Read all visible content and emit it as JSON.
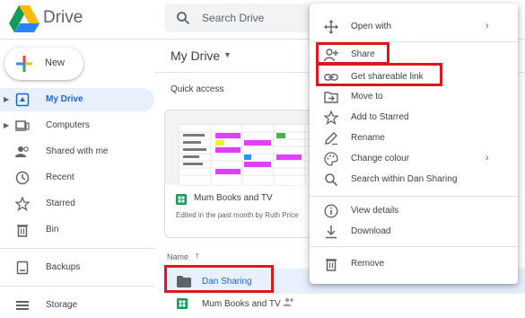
{
  "header": {
    "brand": "Drive",
    "search_placeholder": "Search Drive"
  },
  "sidebar": {
    "new_label": "New",
    "items": [
      {
        "label": "My Drive",
        "icon": "my-drive-icon",
        "selected": true
      },
      {
        "label": "Computers",
        "icon": "computers-icon"
      },
      {
        "label": "Shared with me",
        "icon": "shared-with-me-icon"
      },
      {
        "label": "Recent",
        "icon": "recent-icon"
      },
      {
        "label": "Starred",
        "icon": "star-icon"
      },
      {
        "label": "Bin",
        "icon": "bin-icon"
      },
      {
        "label": "Backups",
        "icon": "backups-icon"
      },
      {
        "label": "Storage",
        "icon": "storage-icon"
      }
    ]
  },
  "main": {
    "title": "My Drive",
    "quick_access": "Quick access",
    "card": {
      "name": "Mum Books and TV",
      "subtitle": "Edited in the past month by Ruth Price"
    },
    "column_header": "Name",
    "rows": [
      {
        "name": "Dan Sharing",
        "type": "folder",
        "selected": true
      },
      {
        "name": "Mum Books and TV",
        "type": "sheet",
        "shared": true
      }
    ]
  },
  "context_menu": {
    "items": [
      {
        "label": "Open with",
        "icon": "open-with-icon",
        "submenu": true
      },
      {
        "label": "Share",
        "icon": "share-person-icon"
      },
      {
        "label": "Get shareable link",
        "icon": "link-icon"
      },
      {
        "label": "Move to",
        "icon": "move-to-icon"
      },
      {
        "label": "Add to Starred",
        "icon": "star-icon"
      },
      {
        "label": "Rename",
        "icon": "rename-icon"
      },
      {
        "label": "Change colour",
        "icon": "palette-icon",
        "submenu": true
      },
      {
        "label": "Search within Dan Sharing",
        "icon": "search-icon"
      },
      {
        "label": "View details",
        "icon": "info-icon"
      },
      {
        "label": "Download",
        "icon": "download-icon"
      },
      {
        "label": "Remove",
        "icon": "trash-icon"
      }
    ]
  },
  "colors": {
    "accent": "#1967d2",
    "selected_bg": "#e8f0fe",
    "annotation_red": "#e0161e",
    "sheets_green": "#0f9d58"
  }
}
